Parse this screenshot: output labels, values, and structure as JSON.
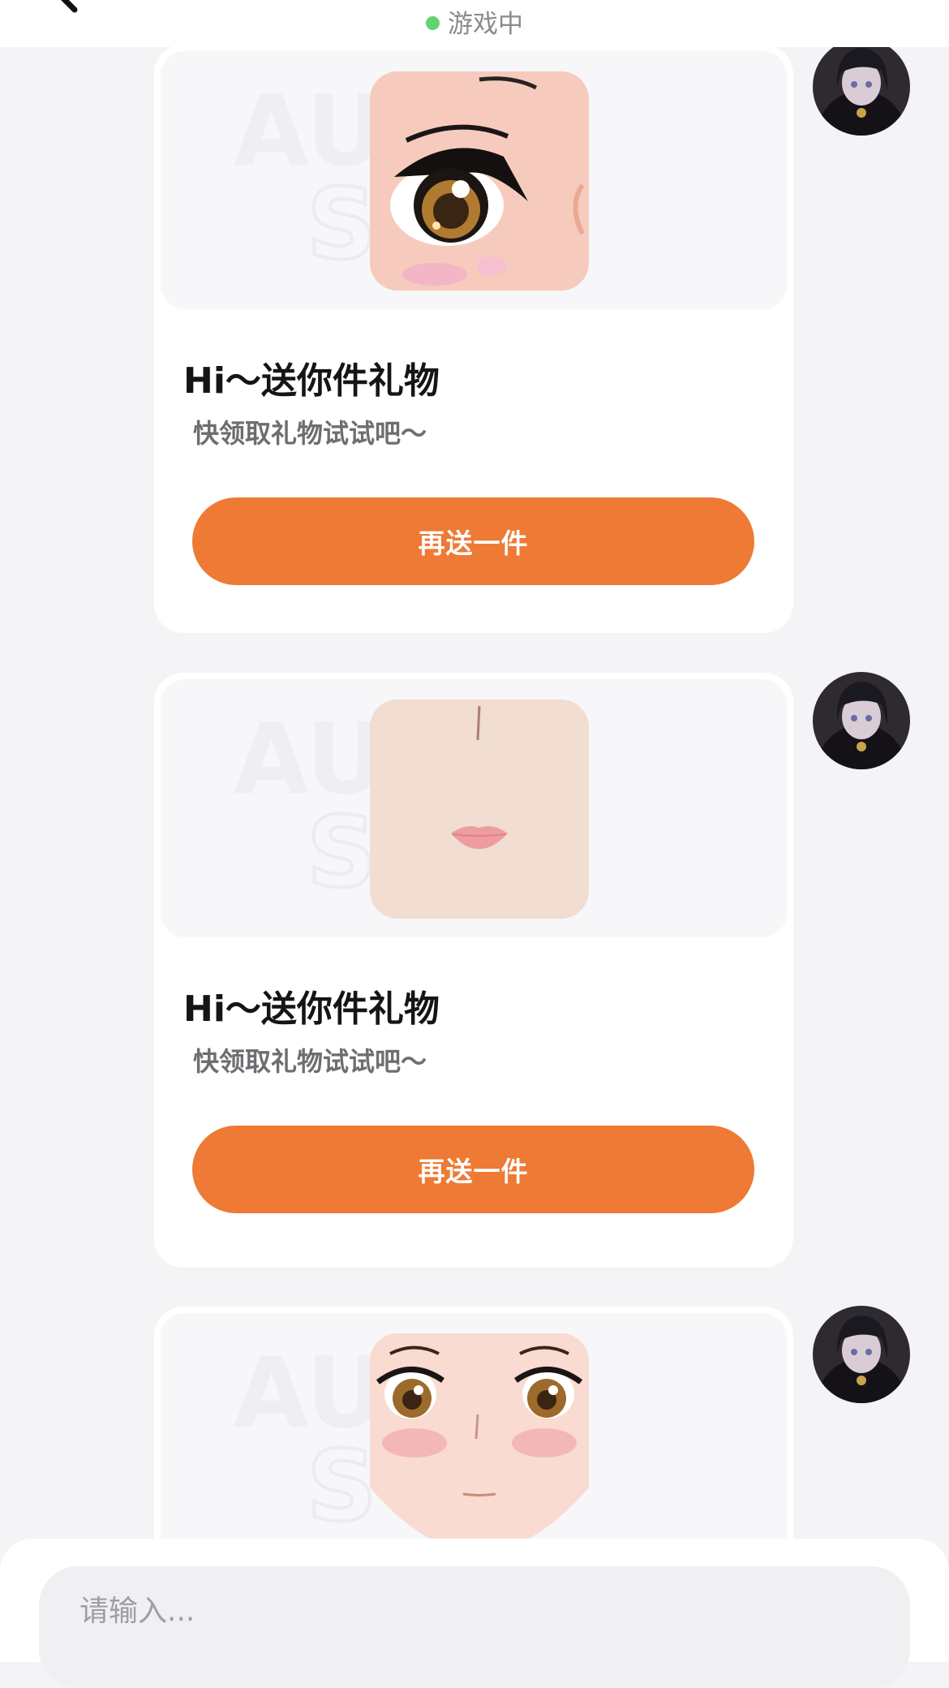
{
  "header": {
    "status_text": "游戏中",
    "status_color": "#62d46e"
  },
  "messages": [
    {
      "gift_image": "gift-eyes-closeup",
      "title": "Hi～送你件礼物",
      "subtitle": "快领取礼物试试吧～",
      "button_label": "再送一件"
    },
    {
      "gift_image": "gift-mouth-nose",
      "title": "Hi～送你件礼物",
      "subtitle": "快领取礼物试试吧～",
      "button_label": "再送一件"
    },
    {
      "gift_image": "gift-full-face"
    }
  ],
  "composer": {
    "placeholder": "请输入..."
  },
  "theme": {
    "accent": "#ee7a35",
    "background": "#f4f3f5"
  },
  "icons": [
    "back-arrow-icon",
    "online-dot-icon",
    "avatar-image"
  ]
}
